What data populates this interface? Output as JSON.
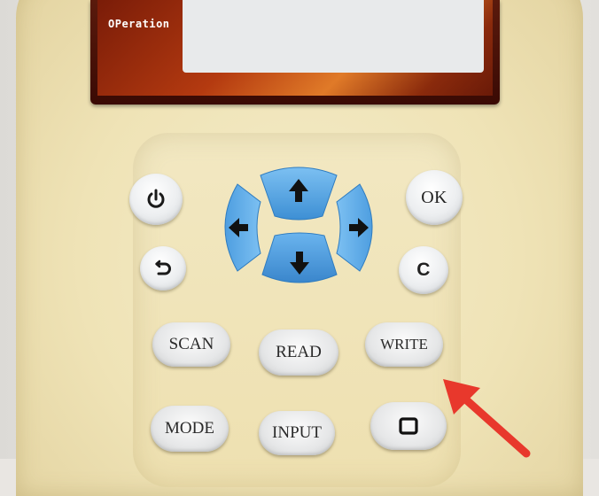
{
  "screen": {
    "label": "OPeration"
  },
  "buttons": {
    "power": "power-icon",
    "ok": "OK",
    "back": "back-icon",
    "cancel": "C",
    "scan": "SCAN",
    "read": "READ",
    "write": "WRITE",
    "mode": "MODE",
    "input": "INPUT",
    "square": "square-icon"
  },
  "dpad": {
    "up": "arrow-up-icon",
    "down": "arrow-down-icon",
    "left": "arrow-left-icon",
    "right": "arrow-right-icon"
  },
  "colors": {
    "device_body": "#efe3b6",
    "dpad_blue": "#5aa8e8",
    "annotation_arrow": "#e8382c"
  }
}
